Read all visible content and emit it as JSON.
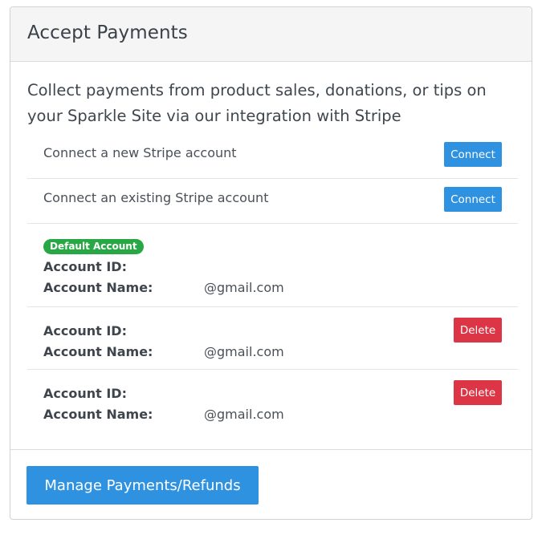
{
  "card": {
    "title": "Accept Payments",
    "intro": "Collect payments from product sales, donations, or tips on your Sparkle Site via our integration with Stripe"
  },
  "connect_options": [
    {
      "label": "Connect a new Stripe account",
      "button": "Connect"
    },
    {
      "label": "Connect an existing Stripe account",
      "button": "Connect"
    }
  ],
  "accounts": [
    {
      "badge": "Default Account",
      "id_label": "Account ID:",
      "id_value": "",
      "name_label": "Account Name:",
      "name_value": "@gmail.com"
    },
    {
      "id_label": "Account ID:",
      "id_value": "",
      "name_label": "Account Name:",
      "name_value": "@gmail.com",
      "delete_label": "Delete"
    },
    {
      "id_label": "Account ID:",
      "id_value": "",
      "name_label": "Account Name:",
      "name_value": "@gmail.com",
      "delete_label": "Delete"
    }
  ],
  "footer": {
    "manage_button": "Manage Payments/Refunds"
  },
  "colors": {
    "primary": "#2f92e0",
    "danger": "#dc3545",
    "success": "#28a745"
  }
}
